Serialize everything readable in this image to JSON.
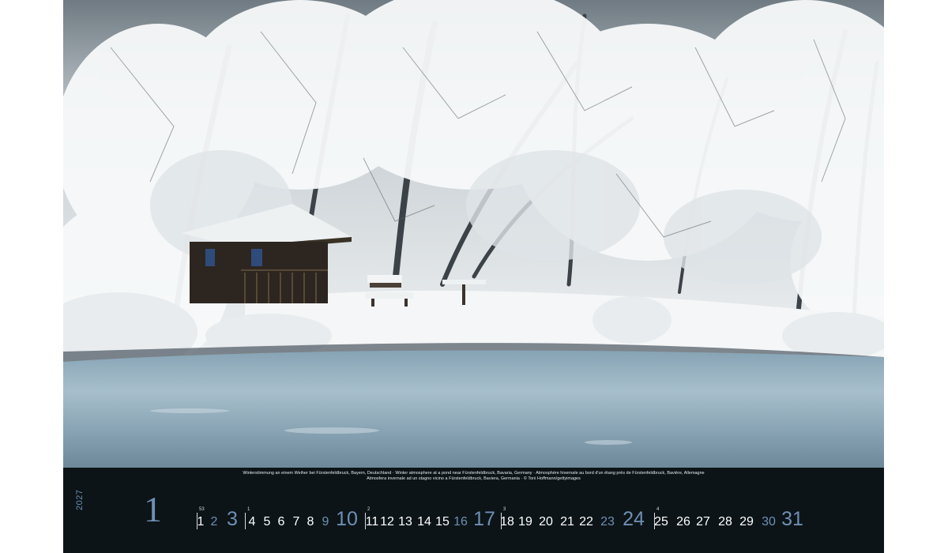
{
  "caption": {
    "line1": "Winterstimmung an einem Weiher bei Fürstenfeldbruck, Bayern, Deutschland · Winter atmosphere at a pond near Fürstenfeldbruck, Bavaria, Germany · Atmosphère hivernale au bord d'un étang près de Fürstenfeldbruck, Bavière, Allemagne",
    "line2": "Atmosfera invernale ad un stagno vicino a Fürstenfeldbruck, Baviera, Germania · © Toni Hoffmann/gettyimages"
  },
  "month": {
    "number": "1",
    "year": "2027"
  },
  "weeks": [
    "53",
    "1",
    "2",
    "3",
    "4"
  ],
  "days": [
    "1",
    "2",
    "3",
    "4",
    "5",
    "6",
    "7",
    "8",
    "9",
    "10",
    "11",
    "12",
    "13",
    "14",
    "15",
    "16",
    "17",
    "18",
    "19",
    "20",
    "21",
    "22",
    "23",
    "24",
    "25",
    "26",
    "27",
    "28",
    "29",
    "30",
    "31"
  ],
  "colors": {
    "background": "#0c1417",
    "accent": "#6f8fb5",
    "text": "#ffffff"
  }
}
